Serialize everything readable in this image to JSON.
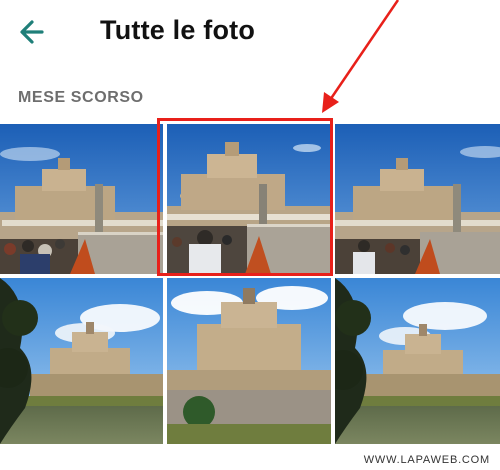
{
  "app": {
    "title": "Tutte le foto",
    "back_icon": "arrow-left-icon",
    "accent": "#1f7f79"
  },
  "section": {
    "label": "MESE SCORSO"
  },
  "photos": [
    {
      "name": "photo-castel-sant-angelo-1",
      "selected": false
    },
    {
      "name": "photo-castel-sant-angelo-2",
      "selected": true
    },
    {
      "name": "photo-castel-sant-angelo-3",
      "selected": false
    },
    {
      "name": "photo-castel-sant-angelo-4",
      "selected": false
    },
    {
      "name": "photo-castel-sant-angelo-5",
      "selected": false
    },
    {
      "name": "photo-castel-sant-angelo-6",
      "selected": false
    }
  ],
  "annotation": {
    "color": "#e8201a"
  },
  "watermark": "WWW.LAPAWEB.COM"
}
